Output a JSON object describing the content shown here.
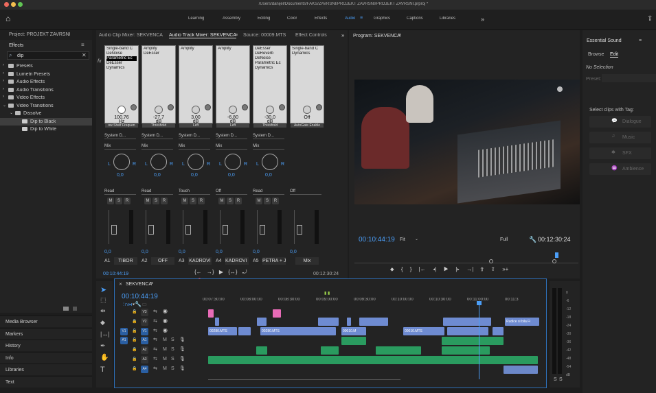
{
  "window": {
    "title": "/Users/danijel/Documents/FAKS/ZAVRSNI/PROJEKT ZAVRSNI/PROJEKT ZAVRSNI.prproj *"
  },
  "workspaces": {
    "tabs": [
      "Learning",
      "Assembly",
      "Editing",
      "Color",
      "Effects",
      "Audio",
      "Graphics",
      "Captions",
      "Libraries"
    ],
    "active": "Audio",
    "more": "»"
  },
  "project": {
    "title": "Project: PROJEKT ZAVRSNI"
  },
  "effects": {
    "tab": "Effects",
    "search": "dip",
    "tree": [
      {
        "label": "Presets",
        "depth": 0,
        "open": false
      },
      {
        "label": "Lumetri Presets",
        "depth": 0,
        "open": false
      },
      {
        "label": "Audio Effects",
        "depth": 0,
        "open": false
      },
      {
        "label": "Audio Transitions",
        "depth": 0,
        "open": false
      },
      {
        "label": "Video Effects",
        "depth": 0,
        "open": false
      },
      {
        "label": "Video Transitions",
        "depth": 0,
        "open": true
      },
      {
        "label": "Dissolve",
        "depth": 1,
        "open": true
      },
      {
        "label": "Dip to Black",
        "depth": 2,
        "selected": true
      },
      {
        "label": "Dip to White",
        "depth": 2
      }
    ]
  },
  "left_panels": [
    "Media Browser",
    "Markers",
    "History",
    "Info",
    "Libraries",
    "Text"
  ],
  "mixer": {
    "tabs": [
      "Audio Clip Mixer: SEKVENCA",
      "Audio Track Mixer: SEKVENCA",
      "Source: 00009.MTS",
      "Effect Controls"
    ],
    "active_tab": "Audio Track Mixer: SEKVENCA",
    "more": "»",
    "channels": [
      {
        "fx": [
          "Single-band C",
          "DeNoise",
          "Parametric Ec",
          "DeEsser",
          "Dynamics"
        ],
        "sel": 2,
        "val": "100,76",
        "unit": "Hz",
        "param": "ow Shelf Frequen",
        "send": "System D...",
        "mix": "Mix",
        "pan": "0,0",
        "auto": "Read",
        "vol": "0,0",
        "id": "A1",
        "name": "TIBOR"
      },
      {
        "fx": [
          "Amplify",
          "DeEsser"
        ],
        "sel": -1,
        "val": "-27,7",
        "unit": "dB",
        "param": "Threshold",
        "send": "System D...",
        "mix": "Mix",
        "pan": "0,0",
        "auto": "Read",
        "vol": "0,0",
        "id": "A2",
        "name": "OFF"
      },
      {
        "fx": [
          "Amplify"
        ],
        "sel": -1,
        "val": "3,00",
        "unit": "dB",
        "param": "Left",
        "send": "System D...",
        "mix": "Mix",
        "pan": "0,0",
        "auto": "Touch",
        "vol": "0,0",
        "id": "A3",
        "name": "KADROVI"
      },
      {
        "fx": [
          "Amplify"
        ],
        "sel": -1,
        "val": "-6,80",
        "unit": "dB",
        "param": "Left",
        "send": "System D...",
        "mix": "Mix",
        "pan": "0,0",
        "auto": "Off",
        "vol": "0,0",
        "id": "A4",
        "name": "KADROVI :"
      },
      {
        "fx": [
          "DeEsser",
          "DeReverb",
          "DeNoise",
          "Parametric Ec",
          "Dynamics"
        ],
        "sel": -1,
        "val": "-30,0",
        "unit": "dB",
        "param": "Threshold",
        "send": "System D...",
        "mix": "Mix",
        "pan": "0,0",
        "auto": "Read",
        "vol": "0,0",
        "id": "A5",
        "name": "PETRA + JE"
      },
      {
        "fx": [
          "Single-band C",
          "Dynamics"
        ],
        "sel": -1,
        "val": "Off",
        "unit": "",
        "param": "AutoGate Enable",
        "send": "",
        "mix": "",
        "pan": "",
        "auto": "Off",
        "vol": "0,0",
        "id": "",
        "name": "Mix"
      }
    ],
    "msr": [
      "M",
      "S",
      "R"
    ],
    "timecode": "00:10:44:19",
    "end": "00:12:30:24"
  },
  "program": {
    "title": "Program: SEKVENCA",
    "timecode": "00:10:44:19",
    "fit": "Fit",
    "full": "Full",
    "duration": "00:12:30:24"
  },
  "essential": {
    "title": "Essential Sound",
    "tabs": [
      "Browse",
      "Edit"
    ],
    "active": "Edit",
    "no_sel": "No Selection",
    "preset": "Preset:",
    "select": "Select clips with Tag:",
    "types": [
      "Dialogue",
      "Music",
      "SFX",
      "Ambience"
    ]
  },
  "timeline": {
    "tab": "SEKVENCA",
    "timecode": "00:10:44:19",
    "ruler": [
      "00:07:30:00",
      "00:08:00:00",
      "00:08:30:00",
      "00:09:00:00",
      "00:09:30:00",
      "00:10:00:00",
      "00:10:30:00",
      "00:11:00:00",
      "00:11:3"
    ],
    "tracks": [
      {
        "src": "",
        "id": "V3",
        "eye": true
      },
      {
        "src": "",
        "id": "V2",
        "eye": true
      },
      {
        "src": "V1",
        "id": "V1",
        "eye": true
      },
      {
        "src": "A1",
        "id": "A1",
        "m": "M",
        "s": "S"
      },
      {
        "src": "",
        "id": "A2",
        "m": "M",
        "s": "S"
      },
      {
        "src": "",
        "id": "A3",
        "m": "M",
        "s": "S"
      },
      {
        "src": "",
        "id": "A4",
        "m": "M",
        "s": "S"
      }
    ],
    "clips": [
      "00280.MTS",
      "00280.MTS",
      "00010.M",
      "00010.MTS",
      "Rudice si bila Fi"
    ]
  },
  "meter": {
    "labels": [
      "0",
      "-6",
      "-12",
      "-18",
      "-24",
      "-30",
      "-36",
      "-42",
      "-48",
      "-54",
      "dB"
    ],
    "solo": [
      "S",
      "S"
    ]
  },
  "colors": {
    "accent": "#2d8ceb",
    "video": "#6e8bd1",
    "audio": "#2a9b5f",
    "pink": "#e86bb7"
  }
}
